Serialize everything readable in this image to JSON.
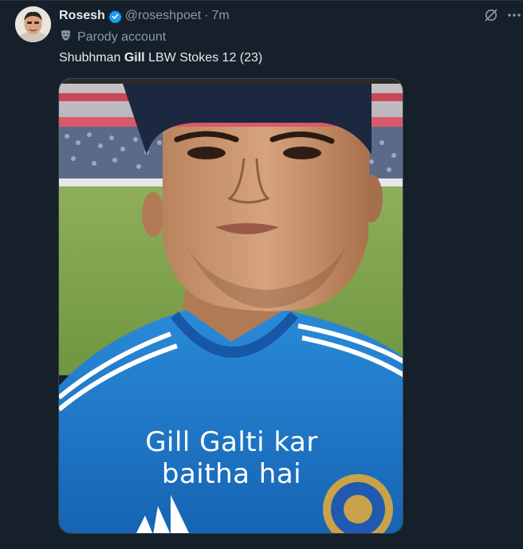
{
  "tweet": {
    "author": {
      "display_name": "Rosesh",
      "handle": "@roseshpoet",
      "verified": true,
      "avatar_icon": "avatar-photo"
    },
    "separator": "·",
    "time": "7m",
    "parody_label": "Parody account",
    "text_before": "Shubhman ",
    "text_bold": "Gill",
    "text_after": " LBW Stokes 12 (23)",
    "media": {
      "caption_line1": "Gill Galti kar",
      "caption_line2": "baitha hai"
    }
  },
  "icons": {
    "grok": "grok-icon",
    "more": "more-icon",
    "parody": "parody-mask-icon",
    "verified": "verified-badge-icon"
  },
  "colors": {
    "background": "#15202b",
    "accent": "#1d9bf0",
    "muted_text": "#8b98a5"
  }
}
